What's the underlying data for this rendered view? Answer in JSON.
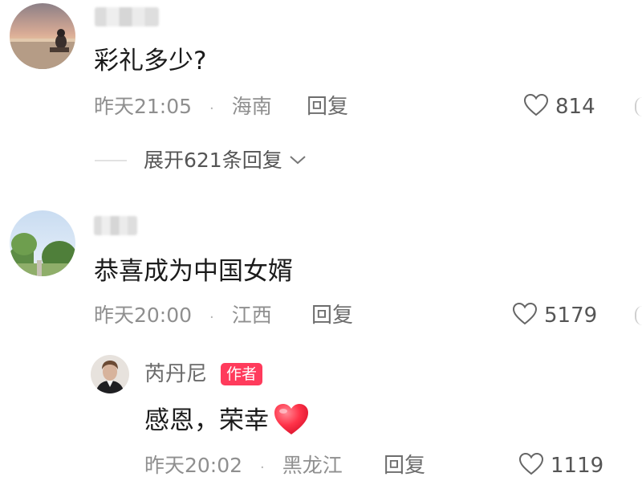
{
  "comments": [
    {
      "text": "彩礼多少?",
      "time": "昨天21:05",
      "separator": "·",
      "location": "海南",
      "reply_label": "回复",
      "likes": "814",
      "expand_replies": "展开621条回复"
    },
    {
      "text": "恭喜成为中国女婿",
      "time": "昨天20:00",
      "separator": "·",
      "location": "江西",
      "reply_label": "回复",
      "likes": "5179",
      "replies": [
        {
          "author": "芮丹尼",
          "badge": "作者",
          "text": "感恩，荣幸",
          "emoji": "heart-emoji",
          "time": "昨天20:02",
          "separator": "·",
          "location": "黑龙江",
          "reply_label": "回复",
          "likes": "1119"
        }
      ]
    }
  ],
  "colors": {
    "badge": "#ff3b5c",
    "meta_gray": "#8f8f8f",
    "text": "#1b1b1b",
    "heart": "#ff2e4d"
  }
}
